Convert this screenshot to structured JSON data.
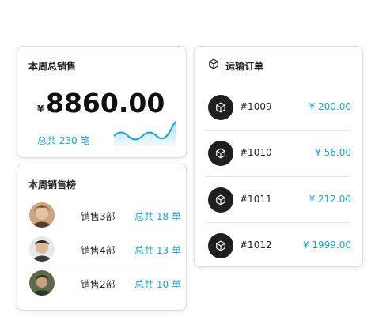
{
  "sales": {
    "title": "本周总销售",
    "currency": "¥",
    "amount": "8860.00",
    "count_text": "总共 230 笔"
  },
  "ranking": {
    "title": "本周销售榜",
    "items": [
      {
        "dept": "销售3部",
        "total": "总共 18 单"
      },
      {
        "dept": "销售4部",
        "total": "总共 13 单"
      },
      {
        "dept": "销售2部",
        "total": "总共 10 单"
      }
    ]
  },
  "orders": {
    "title": "运输订单",
    "icon": "package-icon",
    "items": [
      {
        "id": "#1009",
        "price": "¥ 200.00"
      },
      {
        "id": "#1010",
        "price": "¥ 56.00"
      },
      {
        "id": "#1011",
        "price": "¥ 212.00"
      },
      {
        "id": "#1012",
        "price": "¥ 1999.00"
      }
    ]
  },
  "colors": {
    "accent": "#1a9fd6",
    "badge": "#1f1f1f"
  }
}
